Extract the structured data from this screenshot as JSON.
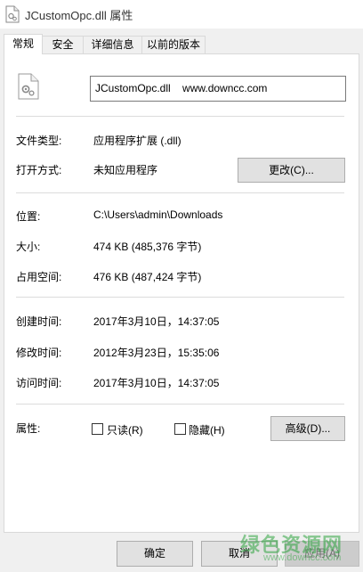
{
  "window": {
    "title": "JCustomOpc.dll 属性",
    "icon": "dll-file-icon"
  },
  "tabs": [
    {
      "label": "常规",
      "active": true
    },
    {
      "label": "安全",
      "active": false
    },
    {
      "label": "详细信息",
      "active": false
    },
    {
      "label": "以前的版本",
      "active": false
    }
  ],
  "general": {
    "file_name": "JCustomOpc.dll    www.downcc.com",
    "file_type_label": "文件类型:",
    "file_type_value": "应用程序扩展 (.dll)",
    "open_with_label": "打开方式:",
    "open_with_value": "未知应用程序",
    "change_button": "更改(C)...",
    "location_label": "位置:",
    "location_value": "C:\\Users\\admin\\Downloads",
    "size_label": "大小:",
    "size_value": "474 KB (485,376 字节)",
    "disk_size_label": "占用空间:",
    "disk_size_value": "476 KB (487,424 字节)",
    "created_label": "创建时间:",
    "created_value": "2017年3月10日，14:37:05",
    "modified_label": "修改时间:",
    "modified_value": "2012年3月23日，15:35:06",
    "accessed_label": "访问时间:",
    "accessed_value": "2017年3月10日，14:37:05",
    "attributes_label": "属性:",
    "readonly_label": "只读(R)",
    "readonly_checked": false,
    "hidden_label": "隐藏(H)",
    "hidden_checked": false,
    "advanced_button": "高级(D)..."
  },
  "footer": {
    "ok_button": "确定",
    "cancel_button": "取消",
    "apply_button": "应用(A)"
  },
  "watermark": {
    "big": "绿色资源网",
    "small": "www.downcc.com"
  }
}
